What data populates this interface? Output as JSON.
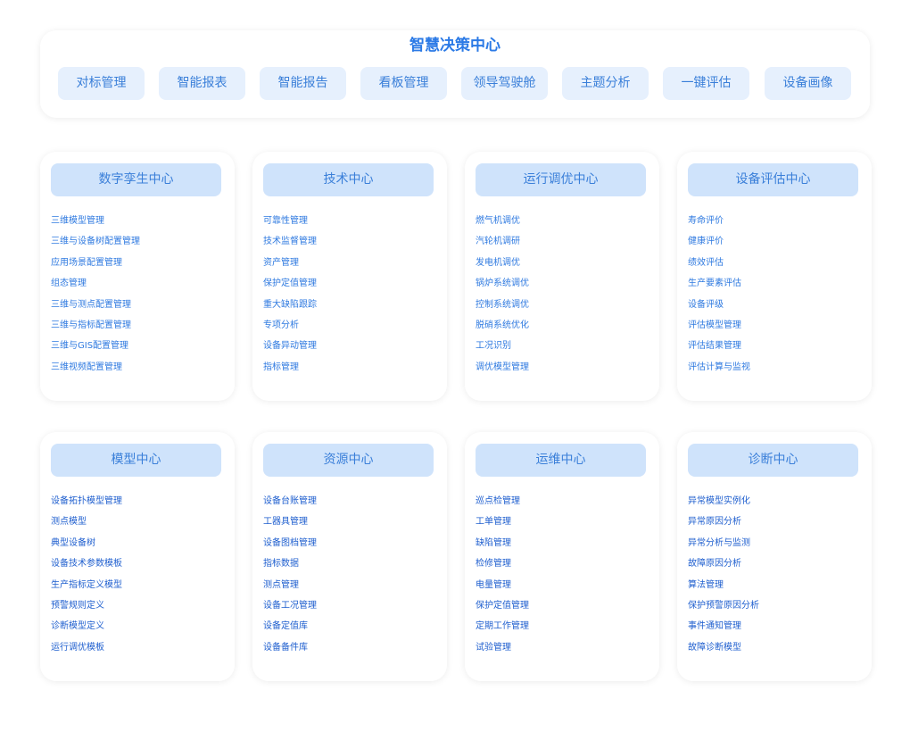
{
  "header": {
    "title": "智慧决策中心",
    "buttons": [
      "对标管理",
      "智能报表",
      "智能报告",
      "看板管理",
      "领导驾驶舱",
      "主题分析",
      "一键评估",
      "设备画像"
    ]
  },
  "cards": [
    {
      "title": "数字孪生中心",
      "items": [
        "三维模型管理",
        "三维与设备树配置管理",
        "应用场景配置管理",
        "组态管理",
        "三维与测点配置管理",
        "三维与指标配置管理",
        "三维与GIS配置管理",
        "三维视频配置管理"
      ]
    },
    {
      "title": "技术中心",
      "items": [
        "可靠性管理",
        "技术监督管理",
        "资产管理",
        "保护定值管理",
        "重大缺陷跟踪",
        "专项分析",
        "设备异动管理",
        "指标管理"
      ]
    },
    {
      "title": "运行调优中心",
      "items": [
        "燃气机调优",
        "汽轮机调研",
        "发电机调优",
        "锅炉系统调优",
        "控制系统调优",
        "脱硝系统优化",
        "工况识别",
        "调优模型管理"
      ]
    },
    {
      "title": "设备评估中心",
      "items": [
        "寿命评价",
        "健康评价",
        "绩效评估",
        "生产要素评估",
        "设备评级",
        "评估模型管理",
        "评估结果管理",
        "评估计算与监视"
      ]
    },
    {
      "title": "模型中心",
      "items": [
        "设备拓扑模型管理",
        "测点模型",
        "典型设备树",
        "设备技术参数模板",
        "生产指标定义模型",
        "预警规则定义",
        "诊断模型定义",
        "运行调优模板"
      ]
    },
    {
      "title": "资源中心",
      "items": [
        "设备台账管理",
        "工器具管理",
        "设备图档管理",
        "指标数据",
        "测点管理",
        "设备工况管理",
        "设备定值库",
        "设备备件库"
      ]
    },
    {
      "title": "运维中心",
      "items": [
        "巡点检管理",
        "工单管理",
        "缺陷管理",
        "检修管理",
        "电量管理",
        "保护定值管理",
        "定期工作管理",
        "试验管理"
      ]
    },
    {
      "title": "诊断中心",
      "items": [
        "异常模型实例化",
        "异常原因分析",
        "异常分析与监测",
        "故障原因分析",
        "算法管理",
        "保护预警原因分析",
        "事件通知管理",
        "故障诊断模型"
      ]
    }
  ]
}
